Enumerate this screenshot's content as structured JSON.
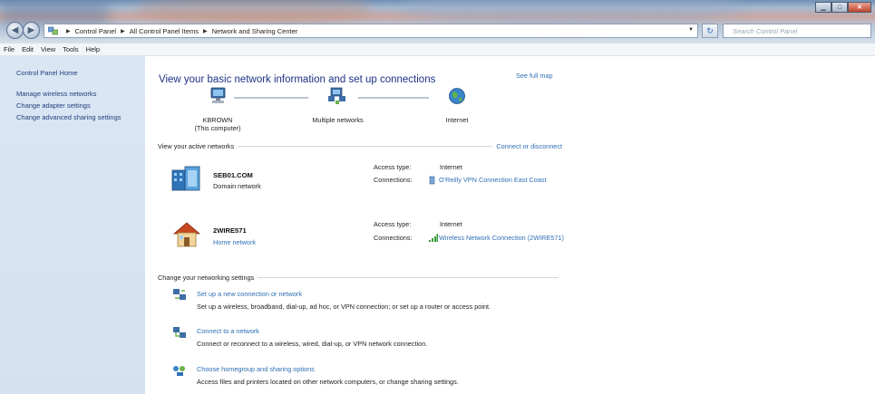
{
  "window": {
    "breadcrumbs": [
      "Control Panel",
      "All Control Panel Items",
      "Network and Sharing Center"
    ],
    "search_placeholder": "Search Control Panel"
  },
  "menu": [
    "File",
    "Edit",
    "View",
    "Tools",
    "Help"
  ],
  "sidebar": {
    "items": [
      {
        "label": "Control Panel Home"
      },
      {
        "label": "Manage wireless networks"
      },
      {
        "label": "Change adapter settings"
      },
      {
        "label": "Change advanced sharing settings"
      }
    ]
  },
  "main": {
    "title": "View your basic network information and set up connections",
    "see_full_map": "See full map",
    "map": {
      "computer_name": "KBROWN",
      "computer_sub": "(This computer)",
      "middle": "Multiple networks",
      "internet": "Internet"
    },
    "active_networks": {
      "heading": "View your active networks",
      "connect_link": "Connect or disconnect",
      "networks": [
        {
          "name": "SEB01.COM",
          "type": "Domain network",
          "access_label": "Access type:",
          "access_value": "Internet",
          "connections_label": "Connections:",
          "connection": "O'Reilly VPN Connection East Coast",
          "icon": "domain-network-icon"
        },
        {
          "name": "2WIRE571",
          "type": "Home network",
          "access_label": "Access type:",
          "access_value": "Internet",
          "connections_label": "Connections:",
          "connection": "Wireless Network Connection (2WIRE571)",
          "icon": "home-network-icon"
        }
      ]
    },
    "settings": {
      "heading": "Change your networking settings",
      "tasks": [
        {
          "link": "Set up a new connection or network",
          "desc": "Set up a wireless, broadband, dial-up, ad hoc, or VPN connection; or set up a router or access point."
        },
        {
          "link": "Connect to a network",
          "desc": "Connect or reconnect to a wireless, wired, dial-up, or VPN network connection."
        },
        {
          "link": "Choose homegroup and sharing options",
          "desc": "Access files and printers located on other network computers, or change sharing settings."
        }
      ]
    }
  },
  "colors": {
    "link": "#2f6fb5",
    "title": "#1e3287",
    "left_pane": "#d7e3f2"
  }
}
